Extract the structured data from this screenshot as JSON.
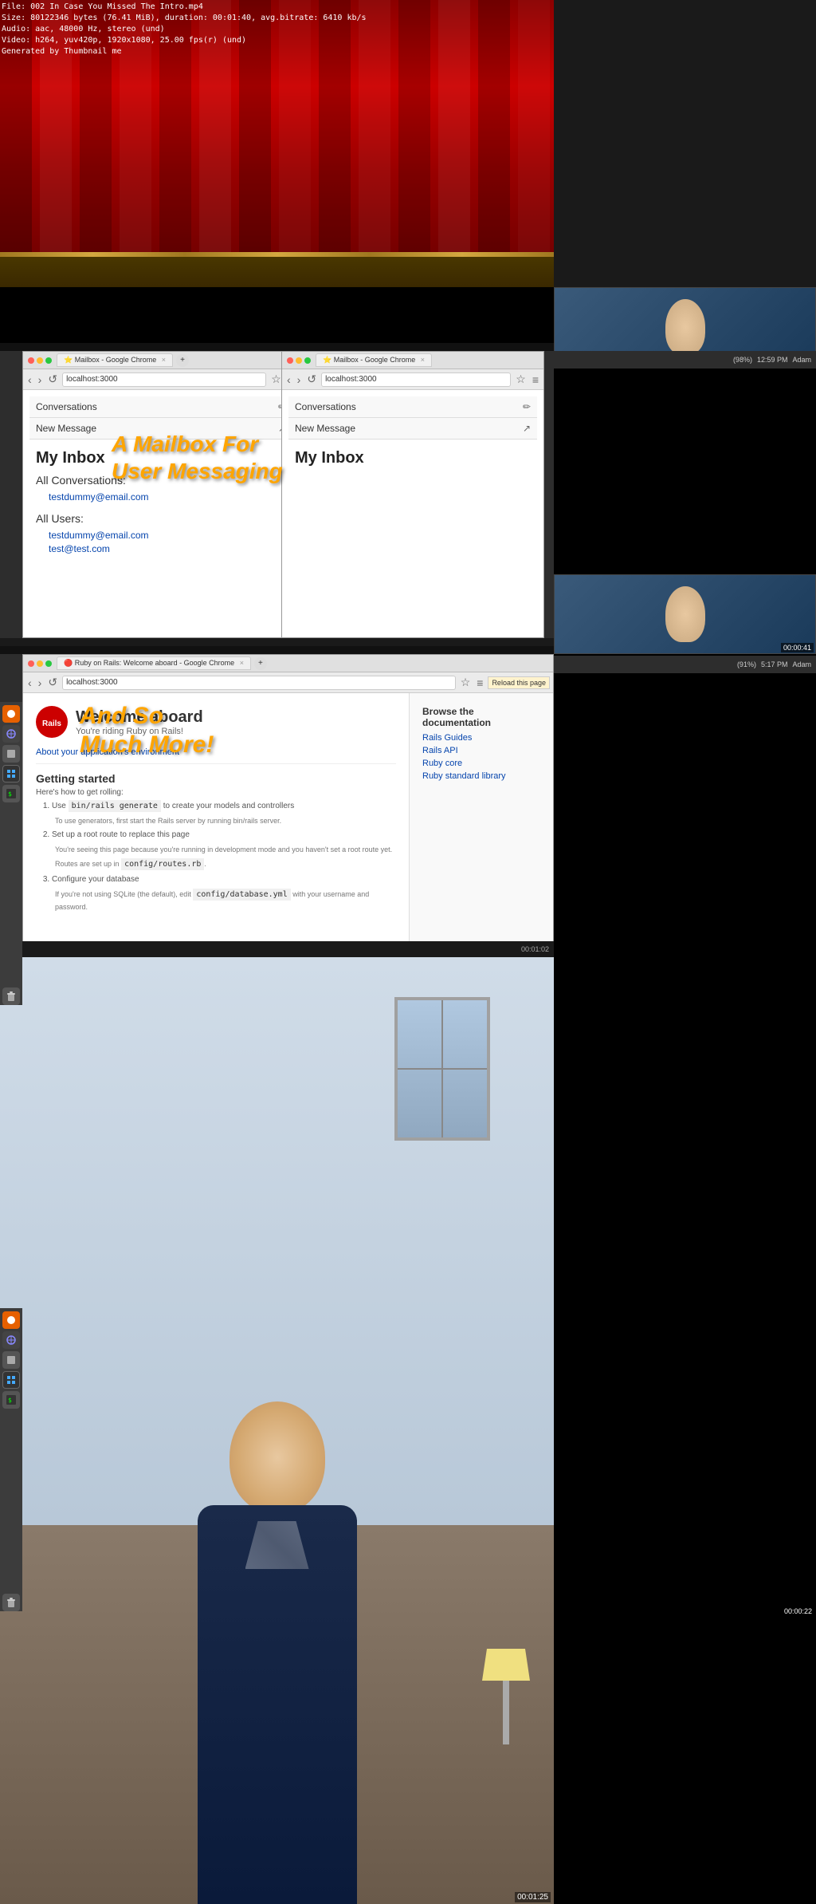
{
  "video": {
    "file_info": {
      "line1": "File: 002 In Case You Missed The Intro.mp4",
      "line2": "Size: 80122346 bytes (76.41 MiB), duration: 00:01:40, avg.bitrate: 6410 kb/s",
      "line3": "Audio: aac, 48000 Hz, stereo (und)",
      "line4": "Video: h264, yuv420p, 1920x1080, 25.00 fps(r) (und)",
      "line5": "Generated by Thumbnail me"
    }
  },
  "browser_left": {
    "title": "Mailbox - Google Chrome",
    "url": "localhost:3000",
    "conversations_label": "Conversations",
    "new_message_label": "New Message",
    "inbox_title": "My Inbox",
    "all_conversations_label": "All Conversations:",
    "conversations_email": "testdummy@email.com",
    "all_users_label": "All Users:",
    "users_emails": [
      "testdummy@email.com",
      "test@test.com"
    ]
  },
  "browser_right": {
    "title": "Mailbox - Google Chrome",
    "url": "localhost:3000",
    "conversations_label": "Conversations",
    "new_message_label": "New Message",
    "inbox_title": "My Inbox"
  },
  "overlay_text_1": {
    "line1": "A Mailbox For",
    "line2": "User Messaging"
  },
  "rails_browser": {
    "title": "Ruby on Rails: Welcome aboard - Google Chrome",
    "url": "localhost:3000",
    "reload_btn": "Reload this page",
    "welcome_title": "Welcome aboard",
    "welcome_sub": "You're riding Ruby on Rails!",
    "env_link": "About your application's environment",
    "getting_started_title": "Getting started",
    "getting_started_sub": "Here's how to get rolling:",
    "steps": [
      {
        "num": 1,
        "text": "Use bin/rails generate to create your models and controllers",
        "notes": [
          "To use generators, first start the Rails server by running bin/rails server.",
          ""
        ]
      },
      {
        "num": 2,
        "text": "Set up a root route to replace this page",
        "notes": [
          "You're seeing this page because you're running in development mode and you haven't set a root route yet.",
          "Routes are set up in config/routes.rb."
        ]
      },
      {
        "num": 3,
        "text": "Configure your database",
        "notes": [
          "If you're not using SQLite (the default), edit config/database.yml with your username and password."
        ]
      }
    ],
    "doc_title": "Browse the documentation",
    "doc_links": [
      "Rails Guides",
      "Rails API",
      "Ruby core",
      "Ruby standard library"
    ]
  },
  "overlay_text_2": {
    "line1": "And So",
    "line2": "Much More!"
  },
  "timestamps": {
    "ts1": "00:00:22",
    "ts2": "00:00:41",
    "ts_rails": "00:01:02",
    "ts_final": "00:01:25"
  },
  "system": {
    "battery1": "(98%)",
    "time1": "12:59 PM",
    "battery2": "(91%)",
    "time2": "5:17 PM",
    "user": "Adam"
  }
}
